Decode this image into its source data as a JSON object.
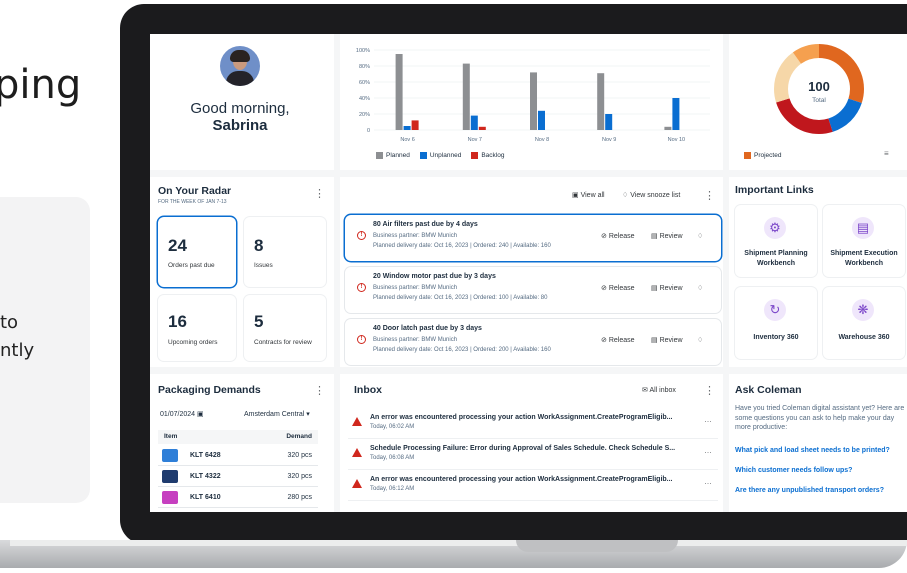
{
  "background": {
    "heading_fragment": "ping",
    "text_lines": [
      "to",
      "ntly"
    ]
  },
  "greeting": {
    "line1": "Good morning,",
    "name": "Sabrina"
  },
  "bar_chart": {
    "chart_data": {
      "type": "bar",
      "categories": [
        "Nov 6",
        "Nov 7",
        "Nov 8",
        "Nov 9",
        "Nov 10"
      ],
      "series": [
        {
          "name": "Planned",
          "values": [
            95,
            83,
            72,
            71,
            4
          ],
          "color": "#8d8f92"
        },
        {
          "name": "Unplanned",
          "values": [
            5,
            18,
            24,
            20,
            40
          ],
          "color": "#0a6ed1"
        },
        {
          "name": "Backlog",
          "values": [
            12,
            4,
            0,
            0,
            0
          ],
          "color": "#d0271d"
        }
      ],
      "y_ticks": [
        "100%",
        "80%",
        "60%",
        "40%",
        "20%",
        "0"
      ],
      "ylim": [
        0,
        100
      ]
    },
    "legend": [
      "Planned",
      "Unplanned",
      "Backlog"
    ]
  },
  "donut": {
    "value": "100",
    "label": "Total",
    "segments": [
      {
        "color": "#e0671f",
        "fraction": 0.3
      },
      {
        "color": "#0a6ed1",
        "fraction": 0.15
      },
      {
        "color": "#c0171d",
        "fraction": 0.25
      },
      {
        "color": "#f6d7a8",
        "fraction": 0.2
      },
      {
        "color": "#f5a04f",
        "fraction": 0.1
      }
    ],
    "legend_label": "Projected",
    "legend_color": "#e0671f"
  },
  "radar": {
    "title": "On Your Radar",
    "subtitle": "FOR THE WEEK OF JAN 7-13",
    "tiles": [
      {
        "number": "24",
        "label": "Orders past due"
      },
      {
        "number": "8",
        "label": "Issues"
      },
      {
        "number": "16",
        "label": "Upcoming orders"
      },
      {
        "number": "5",
        "label": "Contracts for review"
      }
    ],
    "view_all": "View all",
    "view_snooze": "View snooze list"
  },
  "alerts": [
    {
      "title": "80 Air filters past due by 4 days",
      "partner": "Business partner: BMW Munich",
      "details": "Planned delivery date: Oct 16, 2023 | Ordered: 240 | Available: 160",
      "release": "Release",
      "review": "Review"
    },
    {
      "title": "20 Window motor past due by 3 days",
      "partner": "Business partner: BMW Munich",
      "details": "Planned delivery date: Oct 16, 2023 | Ordered: 100 | Available: 80",
      "release": "Release",
      "review": "Review"
    },
    {
      "title": "40 Door latch past due by 3 days",
      "partner": "Business partner: BMW Munich",
      "details": "Planned delivery date: Oct 16, 2023 | Ordered: 200 | Available: 160",
      "release": "Release",
      "review": "Review"
    }
  ],
  "important_links": {
    "title": "Important Links",
    "items": [
      {
        "label1": "Shipment Planning",
        "label2": "Workbench",
        "icon": "gear-icon"
      },
      {
        "label1": "Shipment Execution",
        "label2": "Workbench",
        "icon": "document-icon"
      },
      {
        "label1": "Inventory 360",
        "label2": "",
        "icon": "cycle-icon"
      },
      {
        "label1": "Warehouse 360",
        "label2": "",
        "icon": "network-icon"
      }
    ]
  },
  "packaging": {
    "title": "Packaging Demands",
    "date": "01/07/2024",
    "location": "Amsterdam Central",
    "col_item": "Item",
    "col_demand": "Demand",
    "rows": [
      {
        "name": "KLT 6428",
        "demand": "320 pcs",
        "color": "#2f7fd8"
      },
      {
        "name": "KLT 4322",
        "demand": "320 pcs",
        "color": "#1f3b6e"
      },
      {
        "name": "KLT 6410",
        "demand": "280 pcs",
        "color": "#c63fc0"
      }
    ]
  },
  "inbox": {
    "title": "Inbox",
    "all_inbox": "All inbox",
    "rows": [
      {
        "title": "An error was encountered processing your action WorkAssignment.CreateProgramEligib...",
        "time": "Today, 06:02 AM"
      },
      {
        "title": "Schedule Processing Failure: Error during Approval of Sales Schedule. Check Schedule S...",
        "time": "Today, 06:08 AM"
      },
      {
        "title": "An error was encountered processing your action WorkAssignment.CreateProgramEligib...",
        "time": "Today, 06:12 AM"
      }
    ]
  },
  "ask": {
    "title": "Ask Coleman",
    "intro": "Have you tried Coleman digital assistant yet? Here are some questions you can ask to help make your day more productive:",
    "questions": [
      "What pick and load sheet needs to be printed?",
      "Which customer needs follow ups?",
      "Are there any unpublished transport orders?"
    ]
  }
}
